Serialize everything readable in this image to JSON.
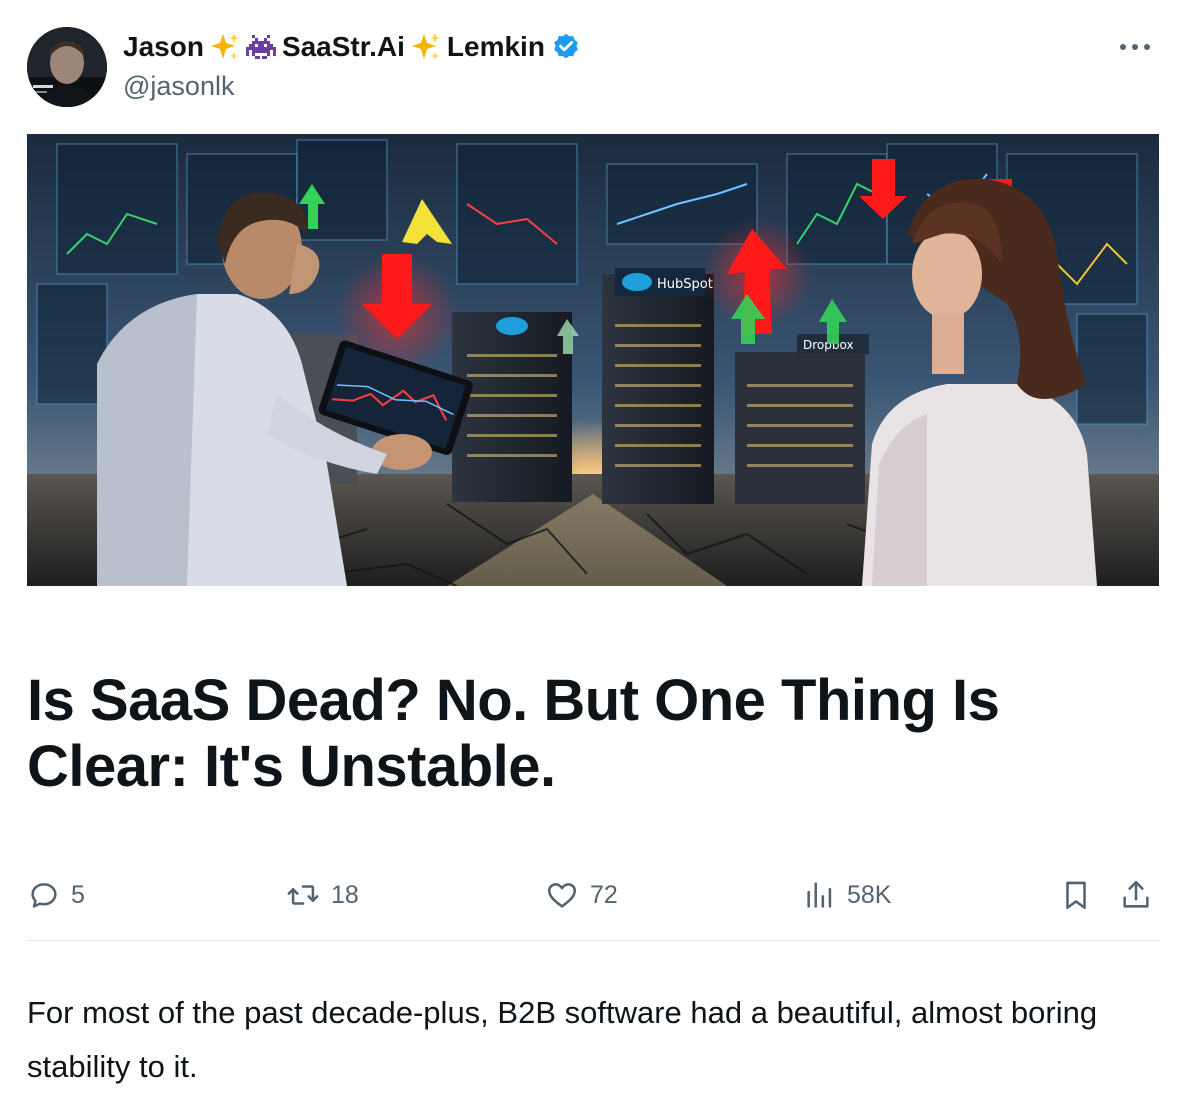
{
  "tweet": {
    "author": {
      "name_first": "Jason",
      "name_mid": "SaaStr.Ai",
      "name_last": "Lemkin",
      "handle": "@jasonlk",
      "verified": true
    },
    "article": {
      "title": "Is SaaS Dead? No. But One Thing Is Clear: It's Unstable.",
      "body": "For most of the past decade-plus, B2B software had a beautiful, almost boring stability to it.",
      "image_labels": {
        "sign_center": "HubSpot",
        "sign_right": "Dropbox"
      }
    },
    "metrics": {
      "replies": "5",
      "reposts": "18",
      "likes": "72",
      "views": "58K"
    }
  },
  "colors": {
    "text_primary": "#0f1419",
    "text_secondary": "#536471",
    "verified_blue": "#1d9bf0",
    "divider": "#e7e9ea",
    "arrow_red": "#ff1a1a",
    "arrow_green": "#34d058",
    "arrow_yellow": "#f2e23a"
  },
  "icons": [
    "sparkles-icon",
    "alien-monster-icon",
    "verified-badge-icon",
    "more-icon",
    "reply-icon",
    "repost-icon",
    "like-icon",
    "views-icon",
    "bookmark-icon",
    "share-icon"
  ]
}
